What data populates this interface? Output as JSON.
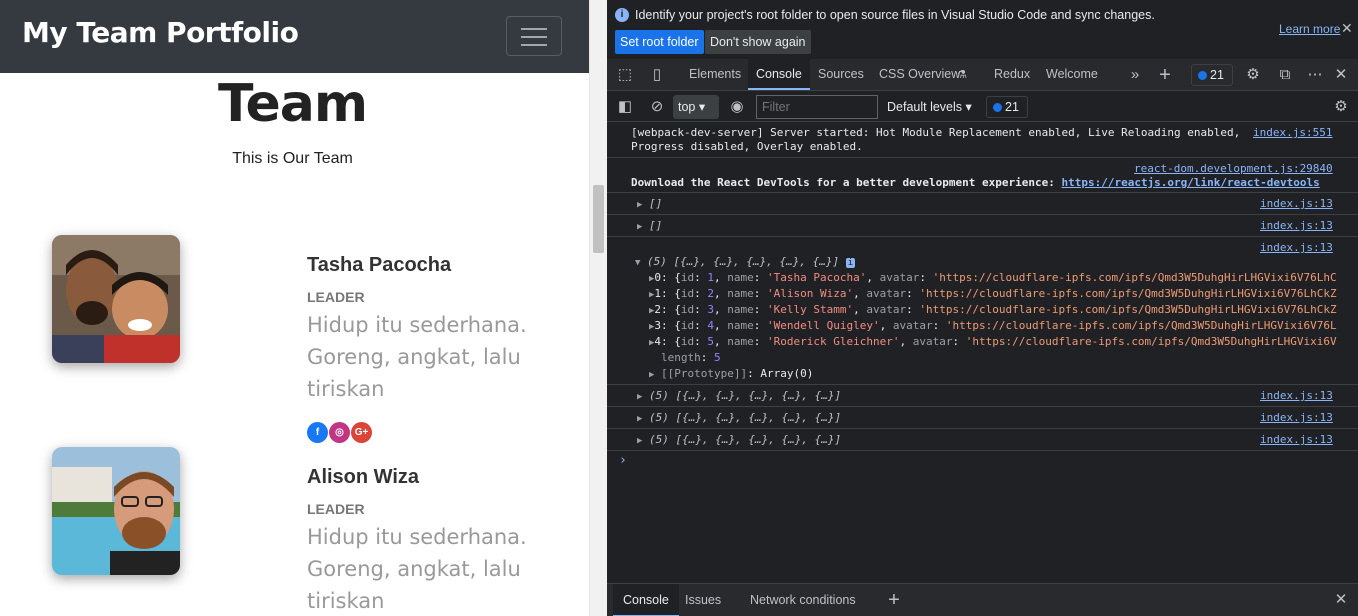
{
  "page": {
    "brand": "My Team Portfolio",
    "title": "Team",
    "subtitle": "This is Our Team",
    "members": [
      {
        "name": "Tasha Pacocha",
        "role": "LEADER",
        "quote": "Hidup itu sederhana. Goreng, angkat, lalu tiriskan"
      },
      {
        "name": "Alison Wiza",
        "role": "LEADER",
        "quote": "Hidup itu sederhana. Goreng, angkat, lalu tiriskan"
      }
    ],
    "socials": [
      {
        "icon": "facebook-icon",
        "glyph": "f",
        "color": "#1877f2"
      },
      {
        "icon": "instagram-icon",
        "glyph": "◎",
        "color": "#c13584"
      },
      {
        "icon": "google-plus-icon",
        "glyph": "G+",
        "color": "#db4437"
      }
    ]
  },
  "devtools": {
    "infobar": {
      "message": "Identify your project's root folder to open source files in Visual Studio Code and sync changes.",
      "learn_more": "Learn more",
      "set_root": "Set root folder",
      "dont_show": "Don't show again"
    },
    "tabs": [
      "Elements",
      "Console",
      "Sources",
      "CSS Overview",
      "Redux",
      "Welcome"
    ],
    "active_tab": "Console",
    "issues_count": "21",
    "toolbar": {
      "context": "top",
      "filter_placeholder": "Filter",
      "levels": "Default levels",
      "issues_count": "21"
    },
    "console": {
      "hmr_line1": "[webpack-dev-server] Server started: Hot Module Replacement enabled, Live Reloading enabled,",
      "hmr_line2": "Progress disabled, Overlay enabled.",
      "hmr_source": "index.js:551",
      "react_source": "react-dom.development.js:29840",
      "react_msg": "Download the React DevTools for a better development experience: ",
      "react_link": "https://reactjs.org/link/react-devtools",
      "empty_array": "[]",
      "array_summary": "(5) [{…}, {…}, {…}, {…}, {…}]",
      "log_source": "index.js:13",
      "entries": [
        {
          "index": "0",
          "id": "1",
          "name": "'Tasha Pacocha'",
          "avatar": "'https://cloudflare-ipfs.com/ipfs/Qmd3W5DuhgHirLHGVixi6V76LhC"
        },
        {
          "index": "1",
          "id": "2",
          "name": "'Alison Wiza'",
          "avatar": "'https://cloudflare-ipfs.com/ipfs/Qmd3W5DuhgHirLHGVixi6V76LhCkZ"
        },
        {
          "index": "2",
          "id": "3",
          "name": "'Kelly Stamm'",
          "avatar": "'https://cloudflare-ipfs.com/ipfs/Qmd3W5DuhgHirLHGVixi6V76LhCkZ"
        },
        {
          "index": "3",
          "id": "4",
          "name": "'Wendell Quigley'",
          "avatar": "'https://cloudflare-ipfs.com/ipfs/Qmd3W5DuhgHirLHGVixi6V76L"
        },
        {
          "index": "4",
          "id": "5",
          "name": "'Roderick Gleichner'",
          "avatar": "'https://cloudflare-ipfs.com/ipfs/Qmd3W5DuhgHirLHGVixi6V"
        }
      ],
      "length_label": "length",
      "length_value": "5",
      "prototype_label": "[[Prototype]]",
      "prototype_value": "Array(0)"
    },
    "drawer_tabs": [
      "Console",
      "Issues",
      "Network conditions"
    ]
  }
}
